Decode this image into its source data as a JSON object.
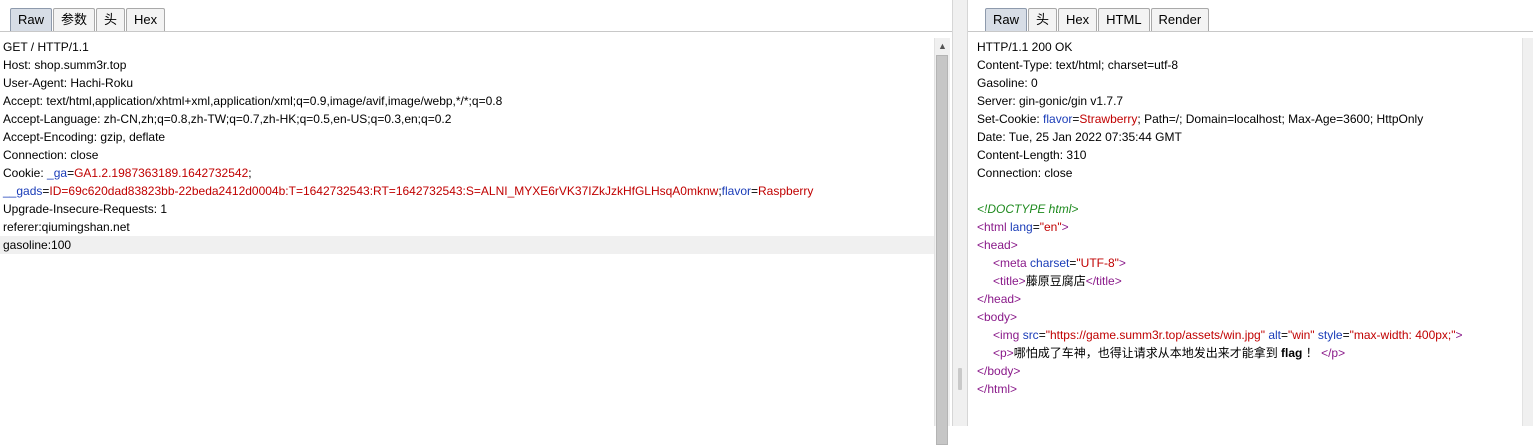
{
  "request": {
    "tabs": [
      "Raw",
      "参数",
      "头",
      "Hex"
    ],
    "active_tab": "Raw",
    "lines": {
      "request_line": "GET / HTTP/1.1",
      "host": "Host: shop.summ3r.top",
      "user_agent": "User-Agent: Hachi-Roku",
      "accept": "Accept: text/html,application/xhtml+xml,application/xml;q=0.9,image/avif,image/webp,*/*;q=0.8",
      "accept_language": "Accept-Language: zh-CN,zh;q=0.8,zh-TW;q=0.7,zh-HK;q=0.5,en-US;q=0.3,en;q=0.2",
      "accept_encoding": "Accept-Encoding: gzip, deflate",
      "connection": "Connection: close",
      "upgrade": "Upgrade-Insecure-Requests: 1",
      "referer": "referer:qiumingshan.net",
      "gasoline": "gasoline:100"
    },
    "cookie": {
      "prefix": "Cookie: ",
      "ga_name": "_ga",
      "ga_value": "GA1.2.1987363189.1642732542",
      "sep1": ";",
      "gads_name": "__gads",
      "gads_value": "ID=69c620dad83823bb-22beda2412d0004b:T=1642732543:RT=1642732543:S=ALNI_MYXE6rVK37IZkJzkHfGLHsqA0mknw",
      "sep2": ";",
      "flavor_name": "flavor",
      "flavor_value": "Raspberry",
      "eq": "="
    }
  },
  "response": {
    "tabs": [
      "Raw",
      "头",
      "Hex",
      "HTML",
      "Render"
    ],
    "active_tab": "Raw",
    "headers": {
      "status": "HTTP/1.1 200 OK",
      "content_type": "Content-Type: text/html; charset=utf-8",
      "gasoline": "Gasoline: 0",
      "server": "Server: gin-gonic/gin v1.7.7",
      "set_cookie_prefix": "Set-Cookie: ",
      "set_cookie_name": "flavor",
      "set_cookie_eq": "=",
      "set_cookie_value": "Strawberry",
      "set_cookie_rest": "; Path=/; Domain=localhost; Max-Age=3600; HttpOnly",
      "date": "Date: Tue, 25 Jan 2022 07:35:44 GMT",
      "content_length": "Content-Length: 310",
      "connection": "Connection: close"
    },
    "body": {
      "doctype": "<!DOCTYPE html>",
      "html_open_tag": "<html ",
      "html_lang_attr": "lang",
      "html_lang_val": "\"en\"",
      "html_open_close": ">",
      "head_open": "<head>",
      "meta_open": "<meta ",
      "meta_attr": "charset",
      "meta_val": "\"UTF-8\"",
      "meta_close": ">",
      "title_open": "<title>",
      "title_text": "藤原豆腐店",
      "title_close": "</title>",
      "head_close": "</head>",
      "body_open": "<body>",
      "img_open": "<img ",
      "img_src_attr": "src",
      "img_src_val": "\"https://game.summ3r.top/assets/win.jpg\"",
      "img_alt_attr": "alt",
      "img_alt_val": "\"win\"",
      "img_style_attr": "style",
      "img_style_val": "\"max-width: 400px;\"",
      "img_close": ">",
      "p_open": "<p>",
      "p_text": "哪怕成了车神，也得让请求从本地发出来才能拿到 ",
      "p_bold": "flag",
      "p_text2": " ！ ",
      "p_close": "</p>",
      "body_close": "</body>",
      "html_close": "</html>",
      "eq": "="
    }
  }
}
